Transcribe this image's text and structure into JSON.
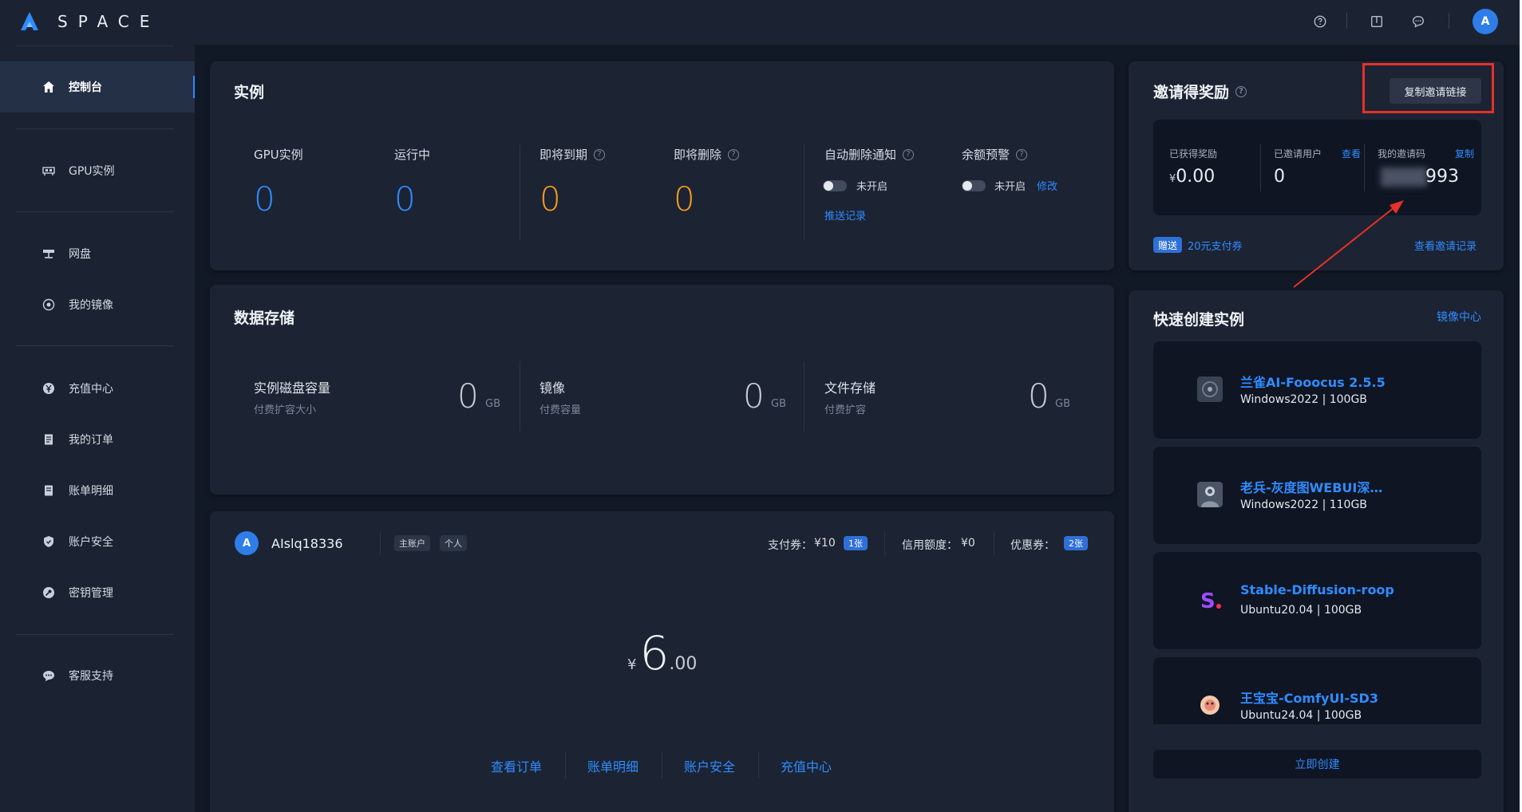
{
  "app": {
    "logo_text": "SPACE"
  },
  "colors": {
    "accent": "#2f8cff",
    "warning": "#f39a1e",
    "background": "#121926",
    "card": "#1c2333",
    "highlight_box": "#e53127"
  },
  "sidebar": {
    "items": [
      {
        "label": "控制台",
        "icon": "home-icon",
        "active": true
      },
      {
        "label": "GPU实例",
        "icon": "gpu-icon"
      },
      {
        "label": "网盘",
        "icon": "network-disk-icon"
      },
      {
        "label": "我的镜像",
        "icon": "image-disc-icon"
      },
      {
        "label": "充值中心",
        "icon": "yen-icon"
      },
      {
        "label": "我的订单",
        "icon": "order-icon"
      },
      {
        "label": "账单明细",
        "icon": "bill-icon"
      },
      {
        "label": "账户安全",
        "icon": "shield-icon"
      },
      {
        "label": "密钥管理",
        "icon": "key-icon"
      },
      {
        "label": "客服支持",
        "icon": "chat-icon"
      }
    ]
  },
  "topbar": {
    "icons": [
      "help-icon",
      "docs-icon",
      "message-icon"
    ],
    "avatar": "A"
  },
  "instances": {
    "title": "实例",
    "gpu_label": "GPU实例",
    "gpu_value": "0",
    "running_label": "运行中",
    "running_value": "0",
    "expiring_label": "即将到期",
    "expiring_value": "0",
    "deleting_label": "即将删除",
    "deleting_value": "0",
    "auto_delete_label": "自动删除通知",
    "auto_delete_state": "未开启",
    "push_record": "推送记录",
    "balance_alert_label": "余额预警",
    "balance_alert_state": "未开启",
    "modify": "修改"
  },
  "storage": {
    "title": "数据存储",
    "items": [
      {
        "label": "实例磁盘容量",
        "sub": "付费扩容大小",
        "value": "0",
        "unit": "GB"
      },
      {
        "label": "镜像",
        "sub": "付费容量",
        "value": "0",
        "unit": "GB"
      },
      {
        "label": "文件存储",
        "sub": "付费扩容",
        "value": "0",
        "unit": "GB"
      }
    ]
  },
  "account": {
    "avatar": "A",
    "username": "AIslq18336",
    "tags": [
      "主账户",
      "个人"
    ],
    "coupon_label": "支付券：",
    "coupon_value": "¥10",
    "coupon_count": "1张",
    "credit_label": "信用额度：",
    "credit_value": "¥0",
    "discount_label": "优惠券：",
    "discount_count": "2张",
    "balance_symbol": "¥",
    "balance_int": "6",
    "balance_dec": ".00",
    "links": [
      "查看订单",
      "账单明细",
      "账户安全",
      "充值中心"
    ]
  },
  "invite": {
    "title": "邀请得奖励",
    "copy_button": "复制邀请链接",
    "earned_label": "已获得奖励",
    "earned_symbol": "¥",
    "earned_value": "0.00",
    "invited_label": "已邀请用户",
    "invited_view": "查看",
    "invited_value": "0",
    "code_label": "我的邀请码",
    "code_copy": "复制",
    "code_value": "993",
    "gift_badge": "赠送",
    "gift_text": "20元支付券",
    "view_records": "查看邀请记录"
  },
  "quick_create": {
    "title": "快速创建实例",
    "image_center": "镜像中心",
    "items": [
      {
        "name": "兰雀AI-Fooocus 2.5.5",
        "spec": "Windows2022 | 100GB",
        "icon": "fooocus-thumbnail"
      },
      {
        "name": "老兵-灰度图WEBUI深…",
        "spec": "Windows2022 | 110GB",
        "icon": "soldier-thumbnail"
      },
      {
        "name": "Stable-Diffusion-roop",
        "spec": "Ubuntu20.04 | 100GB",
        "icon": "s-logo-thumbnail"
      },
      {
        "name": "王宝宝-ComfyUI-SD3",
        "spec": "Ubuntu24.04 | 100GB",
        "icon": "comfy-thumbnail"
      }
    ],
    "create_button": "立即创建"
  }
}
